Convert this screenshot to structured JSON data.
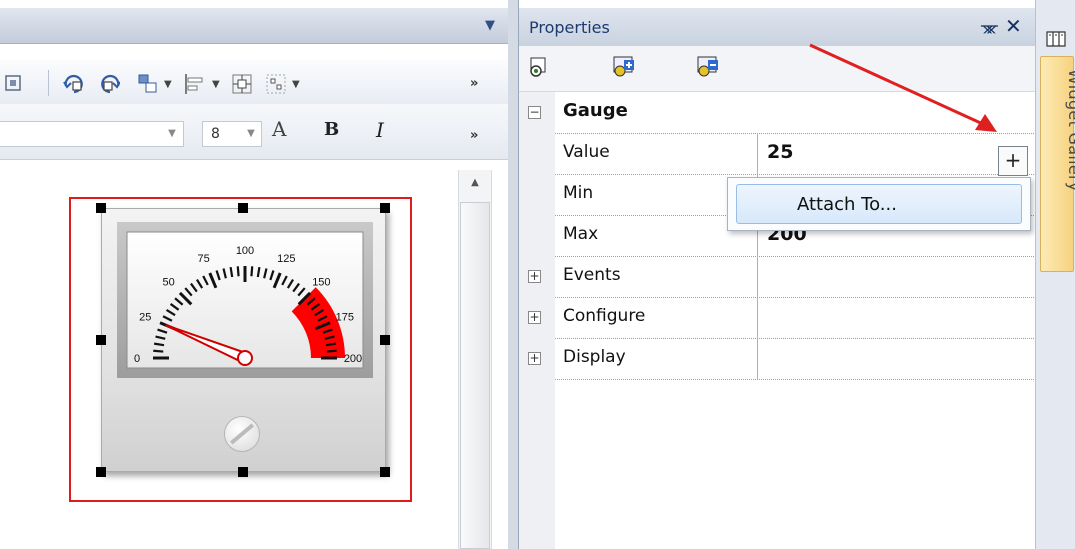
{
  "designer": {
    "font_size_value": "8",
    "bold_label": "B",
    "italic_label": "I",
    "grow_font_label": "A"
  },
  "gauge_widget": {
    "tick_labels": [
      "0",
      "25",
      "50",
      "75",
      "100",
      "125",
      "150",
      "175",
      "200"
    ],
    "needle_value": 25,
    "min": 0,
    "max": 200,
    "red_zone_start": 150,
    "accent_red": "#ff0000",
    "selection_color": "#e01b1b"
  },
  "properties": {
    "title": "Properties",
    "pin_icon": "pin-icon",
    "close_icon": "close-icon",
    "toolbar_icons": [
      "categorized-icon",
      "add-property-icon",
      "remove-property-icon"
    ],
    "group": {
      "label": "Gauge",
      "expander": "−"
    },
    "rows": [
      {
        "label": "Value",
        "value": "25"
      },
      {
        "label": "Min",
        "value": ""
      },
      {
        "label": "Max",
        "value": "200"
      }
    ],
    "collapsed_groups": [
      {
        "label": "Events",
        "expander": "+"
      },
      {
        "label": "Configure",
        "expander": "+"
      },
      {
        "label": "Display",
        "expander": "+"
      }
    ],
    "plus_button_label": "+"
  },
  "context_menu": {
    "items": [
      {
        "label": "Attach To..."
      }
    ]
  },
  "widget_gallery": {
    "label": "Widget Gallery"
  },
  "annotation": {
    "arrow_color": "#e02020"
  }
}
